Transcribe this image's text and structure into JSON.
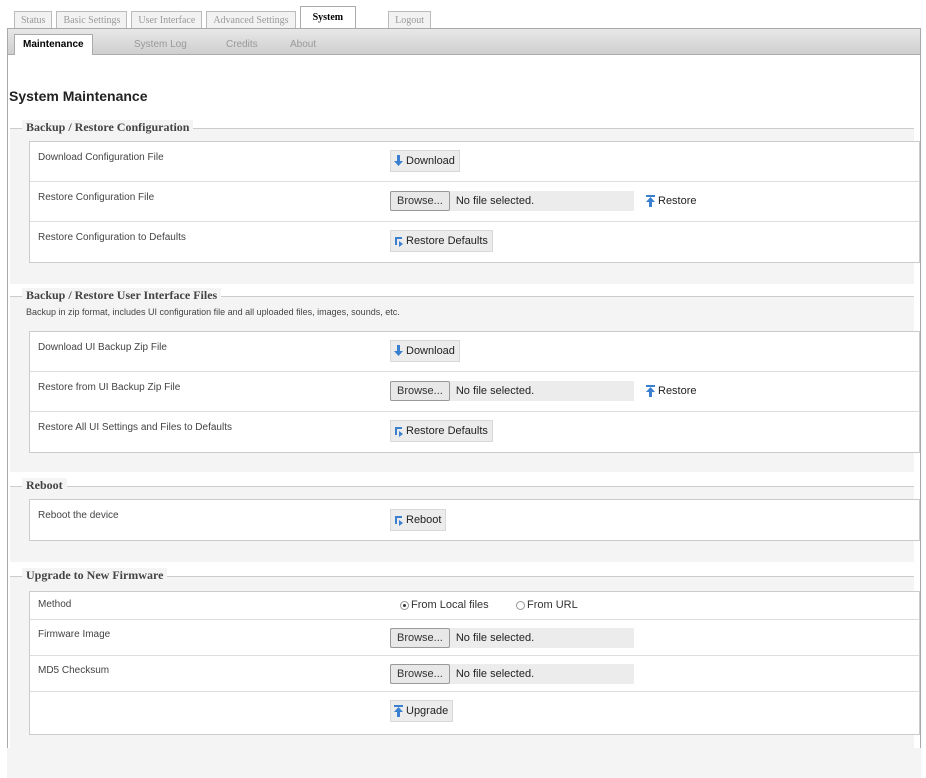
{
  "top_tabs": [
    "Status",
    "Basic Settings",
    "User Interface",
    "Advanced Settings",
    "System",
    "Logout"
  ],
  "sub_tabs": [
    "Maintenance",
    "System Log",
    "Credits",
    "About"
  ],
  "page_title": "System Maintenance",
  "backup_config": {
    "legend": "Backup / Restore Configuration",
    "download_label": "Download Configuration File",
    "download_btn": "Download",
    "restore_label": "Restore Configuration File",
    "browse_btn": "Browse...",
    "no_file": "No file selected.",
    "restore_btn": "Restore",
    "defaults_label": "Restore Configuration to Defaults",
    "defaults_btn": "Restore Defaults"
  },
  "backup_ui": {
    "legend": "Backup / Restore User Interface Files",
    "description": "Backup in zip format, includes UI configuration file and all uploaded files, images, sounds, etc.",
    "download_label": "Download UI Backup Zip File",
    "download_btn": "Download",
    "restore_label": "Restore from UI Backup Zip File",
    "browse_btn": "Browse...",
    "no_file": "No file selected.",
    "restore_btn": "Restore",
    "defaults_label": "Restore All UI Settings and Files to Defaults",
    "defaults_btn": "Restore Defaults"
  },
  "reboot": {
    "legend": "Reboot",
    "label": "Reboot the device",
    "btn": "Reboot"
  },
  "upgrade": {
    "legend": "Upgrade to New Firmware",
    "method_label": "Method",
    "method_local": "From Local files",
    "method_url": "From URL",
    "firmware_label": "Firmware Image",
    "browse_btn": "Browse...",
    "no_file": "No file selected.",
    "md5_label": "MD5 Checksum",
    "upgrade_btn": "Upgrade"
  },
  "colors": {
    "download_icon": "#3a7fd0",
    "restore_icon": "#3a7fd0",
    "defaults_icon": "#3a7fd0"
  }
}
